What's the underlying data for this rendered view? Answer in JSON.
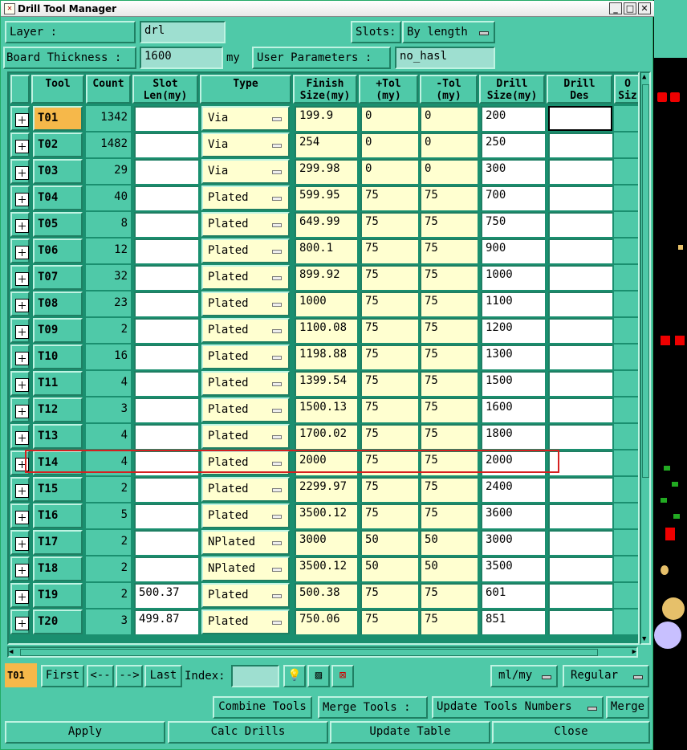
{
  "window": {
    "title": "Drill Tool Manager"
  },
  "top": {
    "layer_label": "Layer            :",
    "layer_value": "drl",
    "slots_label": "Slots:",
    "slots_value": "By length",
    "board_thickness_label": "Board Thickness :",
    "board_thickness_value": "1600",
    "board_thickness_unit": "my",
    "user_params_label": "User Parameters :",
    "user_params_value": "no_hasl"
  },
  "columns": [
    "Tool",
    "Count",
    "Slot\nLen(my)",
    "Type",
    "Finish\nSize(my)",
    "+Tol\n(my)",
    "-Tol\n(my)",
    "Drill\nSize(my)",
    "Drill\nDes",
    "O\nSiz"
  ],
  "rows": [
    {
      "tool": "T01",
      "count": "1342",
      "slot": "",
      "type": "Via",
      "finish": "199.9",
      "ptol": "0",
      "mtol": "0",
      "drill": "200",
      "des": ""
    },
    {
      "tool": "T02",
      "count": "1482",
      "slot": "",
      "type": "Via",
      "finish": "254",
      "ptol": "0",
      "mtol": "0",
      "drill": "250",
      "des": ""
    },
    {
      "tool": "T03",
      "count": "29",
      "slot": "",
      "type": "Via",
      "finish": "299.98",
      "ptol": "0",
      "mtol": "0",
      "drill": "300",
      "des": ""
    },
    {
      "tool": "T04",
      "count": "40",
      "slot": "",
      "type": "Plated",
      "finish": "599.95",
      "ptol": "75",
      "mtol": "75",
      "drill": "700",
      "des": ""
    },
    {
      "tool": "T05",
      "count": "8",
      "slot": "",
      "type": "Plated",
      "finish": "649.99",
      "ptol": "75",
      "mtol": "75",
      "drill": "750",
      "des": ""
    },
    {
      "tool": "T06",
      "count": "12",
      "slot": "",
      "type": "Plated",
      "finish": "800.1",
      "ptol": "75",
      "mtol": "75",
      "drill": "900",
      "des": ""
    },
    {
      "tool": "T07",
      "count": "32",
      "slot": "",
      "type": "Plated",
      "finish": "899.92",
      "ptol": "75",
      "mtol": "75",
      "drill": "1000",
      "des": ""
    },
    {
      "tool": "T08",
      "count": "23",
      "slot": "",
      "type": "Plated",
      "finish": "1000",
      "ptol": "75",
      "mtol": "75",
      "drill": "1100",
      "des": ""
    },
    {
      "tool": "T09",
      "count": "2",
      "slot": "",
      "type": "Plated",
      "finish": "1100.08",
      "ptol": "75",
      "mtol": "75",
      "drill": "1200",
      "des": ""
    },
    {
      "tool": "T10",
      "count": "16",
      "slot": "",
      "type": "Plated",
      "finish": "1198.88",
      "ptol": "75",
      "mtol": "75",
      "drill": "1300",
      "des": ""
    },
    {
      "tool": "T11",
      "count": "4",
      "slot": "",
      "type": "Plated",
      "finish": "1399.54",
      "ptol": "75",
      "mtol": "75",
      "drill": "1500",
      "des": ""
    },
    {
      "tool": "T12",
      "count": "3",
      "slot": "",
      "type": "Plated",
      "finish": "1500.13",
      "ptol": "75",
      "mtol": "75",
      "drill": "1600",
      "des": ""
    },
    {
      "tool": "T13",
      "count": "4",
      "slot": "",
      "type": "Plated",
      "finish": "1700.02",
      "ptol": "75",
      "mtol": "75",
      "drill": "1800",
      "des": ""
    },
    {
      "tool": "T14",
      "count": "4",
      "slot": "",
      "type": "Plated",
      "finish": "2000",
      "ptol": "75",
      "mtol": "75",
      "drill": "2000",
      "des": ""
    },
    {
      "tool": "T15",
      "count": "2",
      "slot": "",
      "type": "Plated",
      "finish": "2299.97",
      "ptol": "75",
      "mtol": "75",
      "drill": "2400",
      "des": ""
    },
    {
      "tool": "T16",
      "count": "5",
      "slot": "",
      "type": "Plated",
      "finish": "3500.12",
      "ptol": "75",
      "mtol": "75",
      "drill": "3600",
      "des": ""
    },
    {
      "tool": "T17",
      "count": "2",
      "slot": "",
      "type": "NPlated",
      "finish": "3000",
      "ptol": "50",
      "mtol": "50",
      "drill": "3000",
      "des": ""
    },
    {
      "tool": "T18",
      "count": "2",
      "slot": "",
      "type": "NPlated",
      "finish": "3500.12",
      "ptol": "50",
      "mtol": "50",
      "drill": "3500",
      "des": ""
    },
    {
      "tool": "T19",
      "count": "2",
      "slot": "500.37",
      "type": "Plated",
      "finish": "500.38",
      "ptol": "75",
      "mtol": "75",
      "drill": "601",
      "des": ""
    },
    {
      "tool": "T20",
      "count": "3",
      "slot": "499.87",
      "type": "Plated",
      "finish": "750.06",
      "ptol": "75",
      "mtol": "75",
      "drill": "851",
      "des": ""
    }
  ],
  "selected_tool": "T01",
  "highlighted_tool": "T14",
  "nav": {
    "current": "T01",
    "first": "First",
    "prev": "<--",
    "next": "-->",
    "last": "Last",
    "index_label": "Index:",
    "units": "ml/my",
    "mode": "Regular"
  },
  "actions": {
    "combine": "Combine Tools",
    "merge_label": "Merge Tools :",
    "merge_value": "Update Tools Numbers",
    "merge_btn": "Merge",
    "apply": "Apply",
    "calc": "Calc Drills",
    "update": "Update Table",
    "close": "Close"
  },
  "colors": {
    "panel": "#4fc9a8",
    "selected": "#f6b84a",
    "highlight_box": "#d62020",
    "yellow_field": "#ffffd0"
  }
}
